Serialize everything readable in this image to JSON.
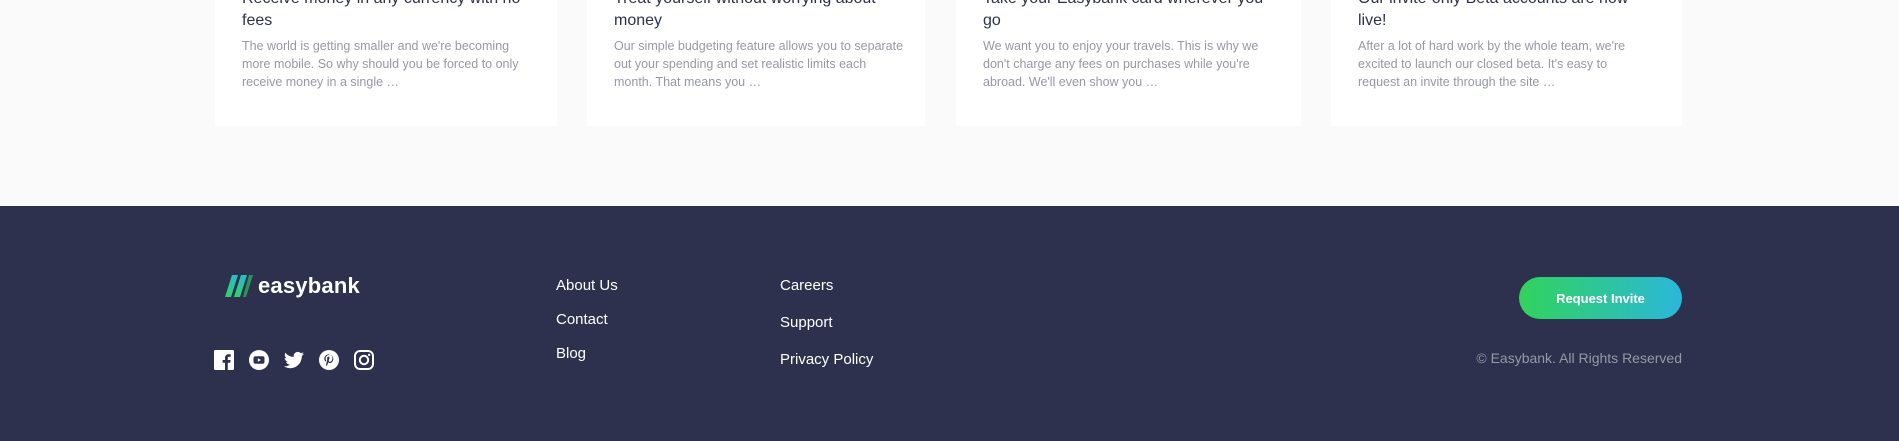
{
  "articles": [
    {
      "title": "Receive money in any currency with no fees",
      "excerpt": "The world is getting smaller and we're becoming more mobile. So why should you be forced to only receive money in a single …"
    },
    {
      "title": "Treat yourself without worrying about money",
      "excerpt": "Our simple budgeting feature allows you to separate out your spending and set realistic limits each month. That means you …"
    },
    {
      "title": "Take your Easybank card wherever you go",
      "excerpt": "We want you to enjoy your travels. This is why we don't charge any fees on purchases while you're abroad. We'll even show you …"
    },
    {
      "title": "Our invite-only Beta accounts are now live!",
      "excerpt": "After a lot of hard work by the whole team, we're excited to launch our closed beta. It's easy to request an invite through the site …"
    }
  ],
  "footer": {
    "logo_text": "easybank",
    "social_icons": [
      "facebook-icon",
      "youtube-icon",
      "twitter-icon",
      "pinterest-icon",
      "instagram-icon"
    ],
    "links_col1": [
      "About Us",
      "Contact",
      "Blog"
    ],
    "links_col2": [
      "Careers",
      "Support",
      "Privacy Policy"
    ],
    "cta_label": "Request Invite",
    "copyright": "© Easybank. All Rights Reserved"
  },
  "colors": {
    "footer_bg": "#2d314d",
    "page_bg": "#fafafa",
    "gradient_start": "#31d35c",
    "gradient_end": "#2bb7da",
    "muted_text": "#9698a6"
  }
}
